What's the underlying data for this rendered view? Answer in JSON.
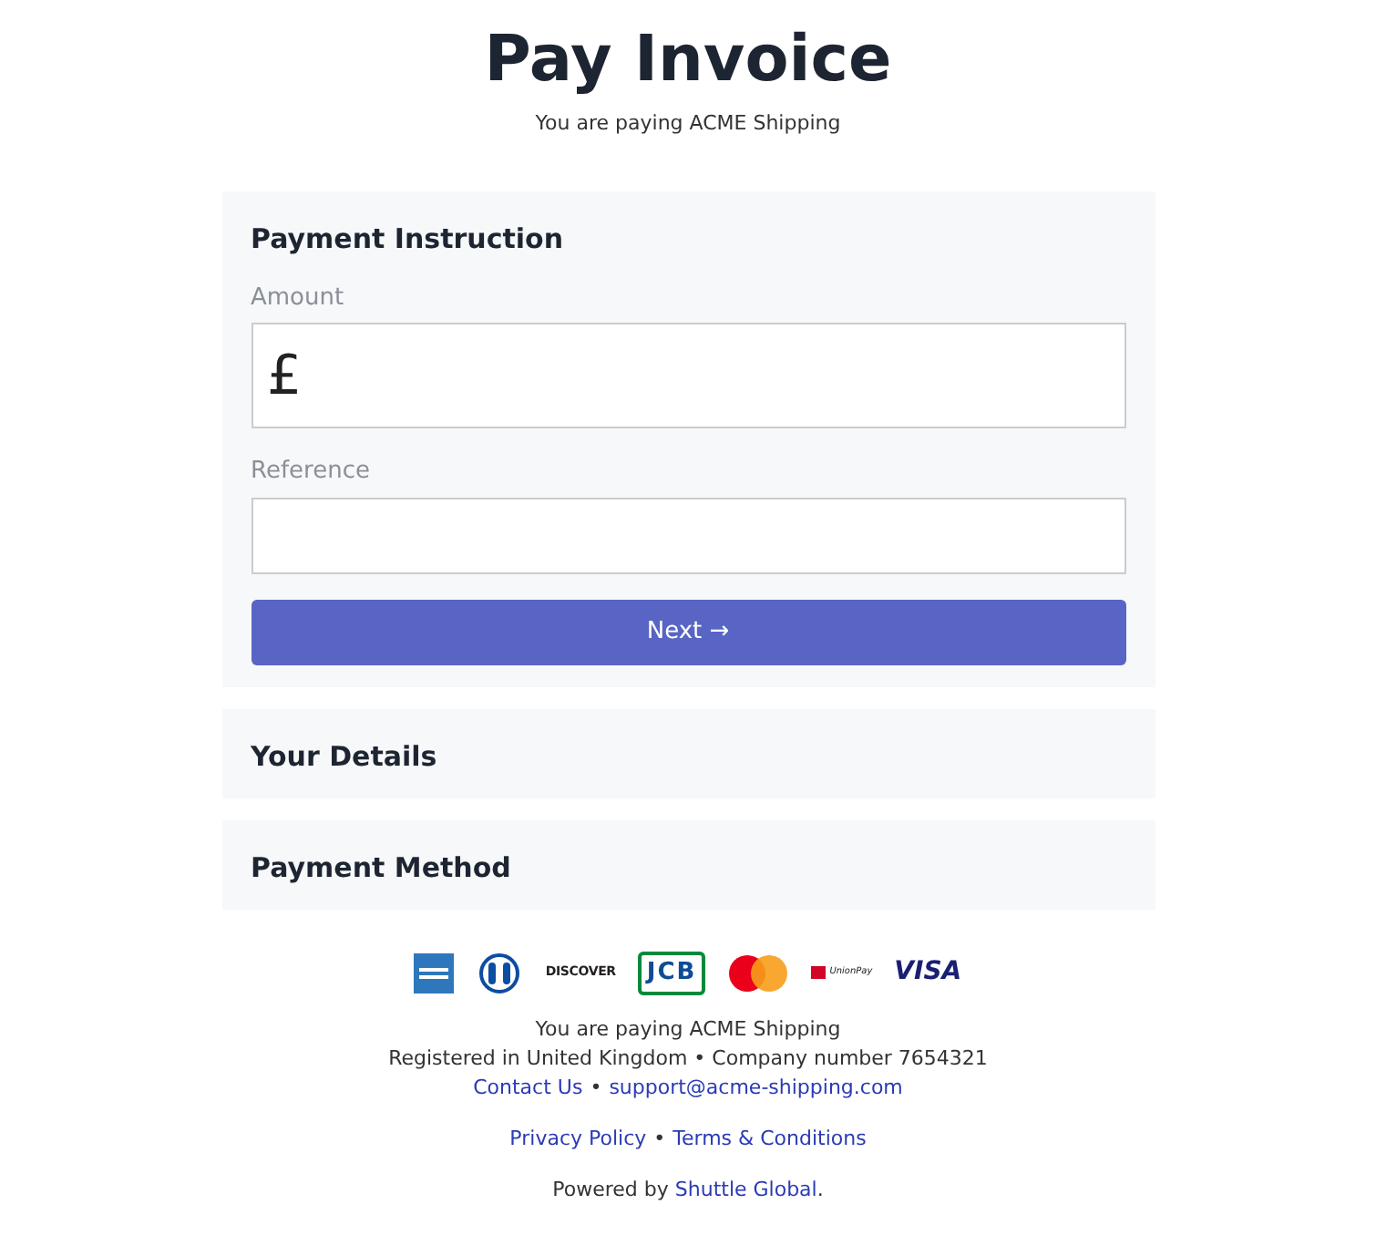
{
  "header": {
    "title": "Pay Invoice",
    "subtitle": "You are paying ACME Shipping"
  },
  "sections": [
    {
      "title": "Payment Instruction",
      "expanded": true,
      "fields": [
        {
          "label": "Amount",
          "prefix": "£",
          "kind": "amount"
        },
        {
          "label": "Reference",
          "kind": "text"
        }
      ],
      "button": "Next →"
    },
    {
      "title": "Your Details",
      "expanded": false
    },
    {
      "title": "Payment Method",
      "expanded": false
    }
  ],
  "cards": [
    {
      "kind": "amex"
    },
    {
      "kind": "diners"
    },
    {
      "kind": "discover",
      "label": "DISCOVER"
    },
    {
      "kind": "jcb",
      "label": "JCB"
    },
    {
      "kind": "mastercard"
    },
    {
      "kind": "unionpay",
      "label": "UnionPay"
    },
    {
      "kind": "visa",
      "label": "VISA"
    }
  ],
  "footer": {
    "payee": "You are paying ACME Shipping",
    "registration": "Registered in United Kingdom • Company number 7654321",
    "contact_link": "Contact Us",
    "separator": "•",
    "email_link": "support@acme-shipping.com",
    "privacy_link": "Privacy Policy",
    "terms_link": "Terms & Conditions",
    "powered_by": "Powered by",
    "powered_link": "Shuttle Global",
    "powered_end": "."
  }
}
